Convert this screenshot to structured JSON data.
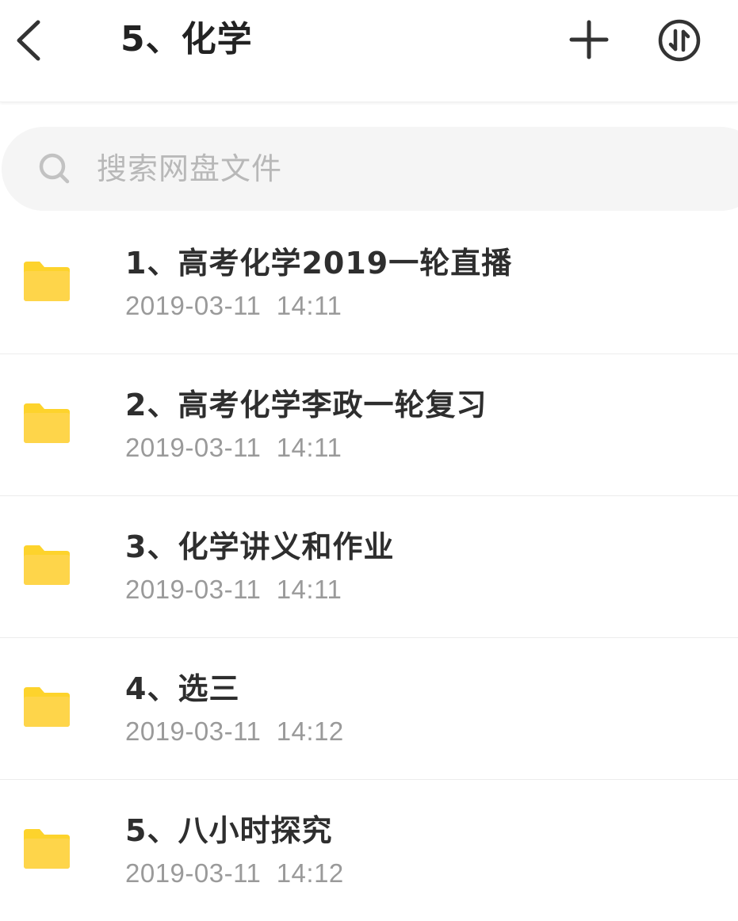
{
  "header": {
    "title": "5、化学",
    "back_icon": "chevron-left-icon",
    "add_icon": "plus-icon",
    "sort_icon": "sort-arrows-icon"
  },
  "search": {
    "placeholder": "搜索网盘文件",
    "icon": "search-icon"
  },
  "files": [
    {
      "name": "1、高考化学2019一轮直播",
      "date": "2019-03-11  14:11",
      "icon": "folder-icon"
    },
    {
      "name": "2、高考化学李政一轮复习",
      "date": "2019-03-11  14:11",
      "icon": "folder-icon"
    },
    {
      "name": "3、化学讲义和作业",
      "date": "2019-03-11  14:11",
      "icon": "folder-icon"
    },
    {
      "name": "4、选三",
      "date": "2019-03-11  14:12",
      "icon": "folder-icon"
    },
    {
      "name": "5、八小时探究",
      "date": "2019-03-11  14:12",
      "icon": "folder-icon"
    }
  ],
  "colors": {
    "folder": "#FDD32C",
    "title_text": "#222222",
    "secondary_text": "#9A9A9A",
    "search_bg": "#F5F5F5"
  }
}
